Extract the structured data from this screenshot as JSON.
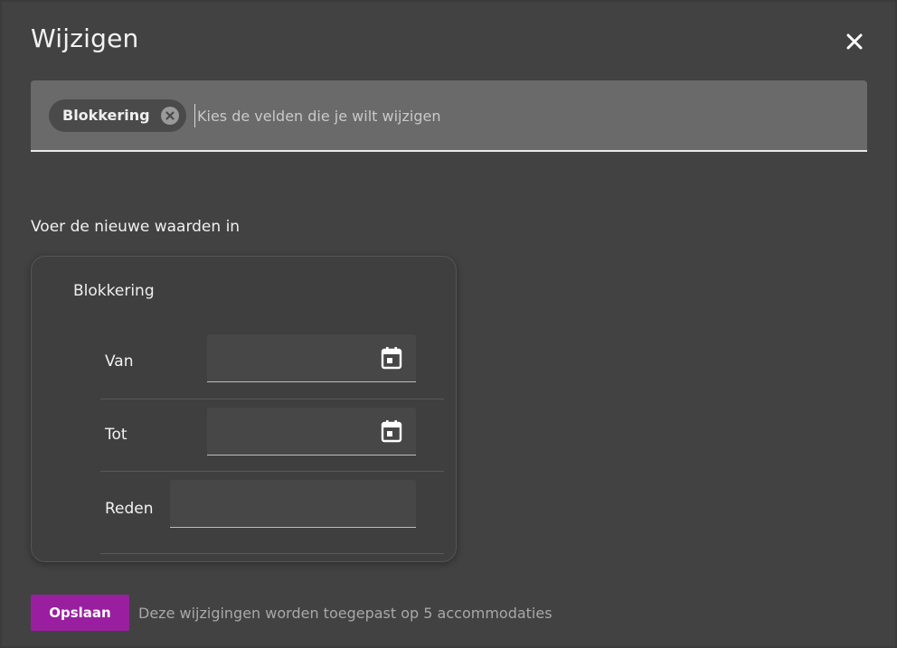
{
  "dialog": {
    "title": "Wijzigen",
    "close_icon": "close-icon"
  },
  "field_selector": {
    "chips": [
      {
        "label": "Blokkering",
        "remove_icon": "remove-circle-icon"
      }
    ],
    "placeholder": "Kies de velden die je wilt wijzigen",
    "value": ""
  },
  "section_label": "Voer de nieuwe waarden in",
  "card": {
    "title": "Blokkering",
    "fields": [
      {
        "label": "Van",
        "value": "",
        "icon": "calendar-icon"
      },
      {
        "label": "Tot",
        "value": "",
        "icon": "calendar-icon"
      },
      {
        "label": "Reden",
        "value": ""
      }
    ]
  },
  "footer": {
    "save_label": "Opslaan",
    "hint": "Deze wijzigingen worden toegepast op 5 accommodaties"
  },
  "colors": {
    "accent": "#9a1fa0",
    "background": "#424242",
    "field_background": "#6a6a6a"
  }
}
